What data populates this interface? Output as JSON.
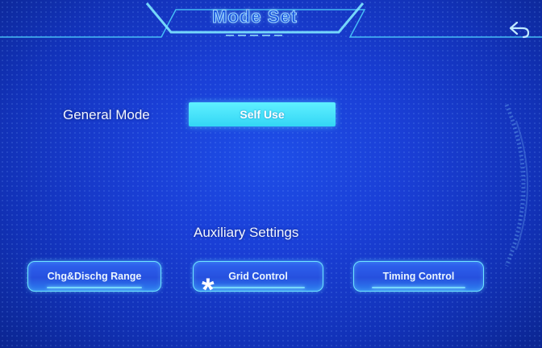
{
  "header": {
    "title": "Mode Set"
  },
  "general_mode": {
    "label": "General Mode",
    "value": "Self Use"
  },
  "auxiliary": {
    "heading": "Auxiliary Settings",
    "buttons": [
      "Chg&Dischg Range",
      "Grid Control",
      "Timing Control"
    ]
  },
  "marker": "*",
  "icons": {
    "back": "back-arrow-icon"
  },
  "colors": {
    "background": "#1a3fd6",
    "accent": "#4fe8ff",
    "frame": "#6fe6ff"
  }
}
